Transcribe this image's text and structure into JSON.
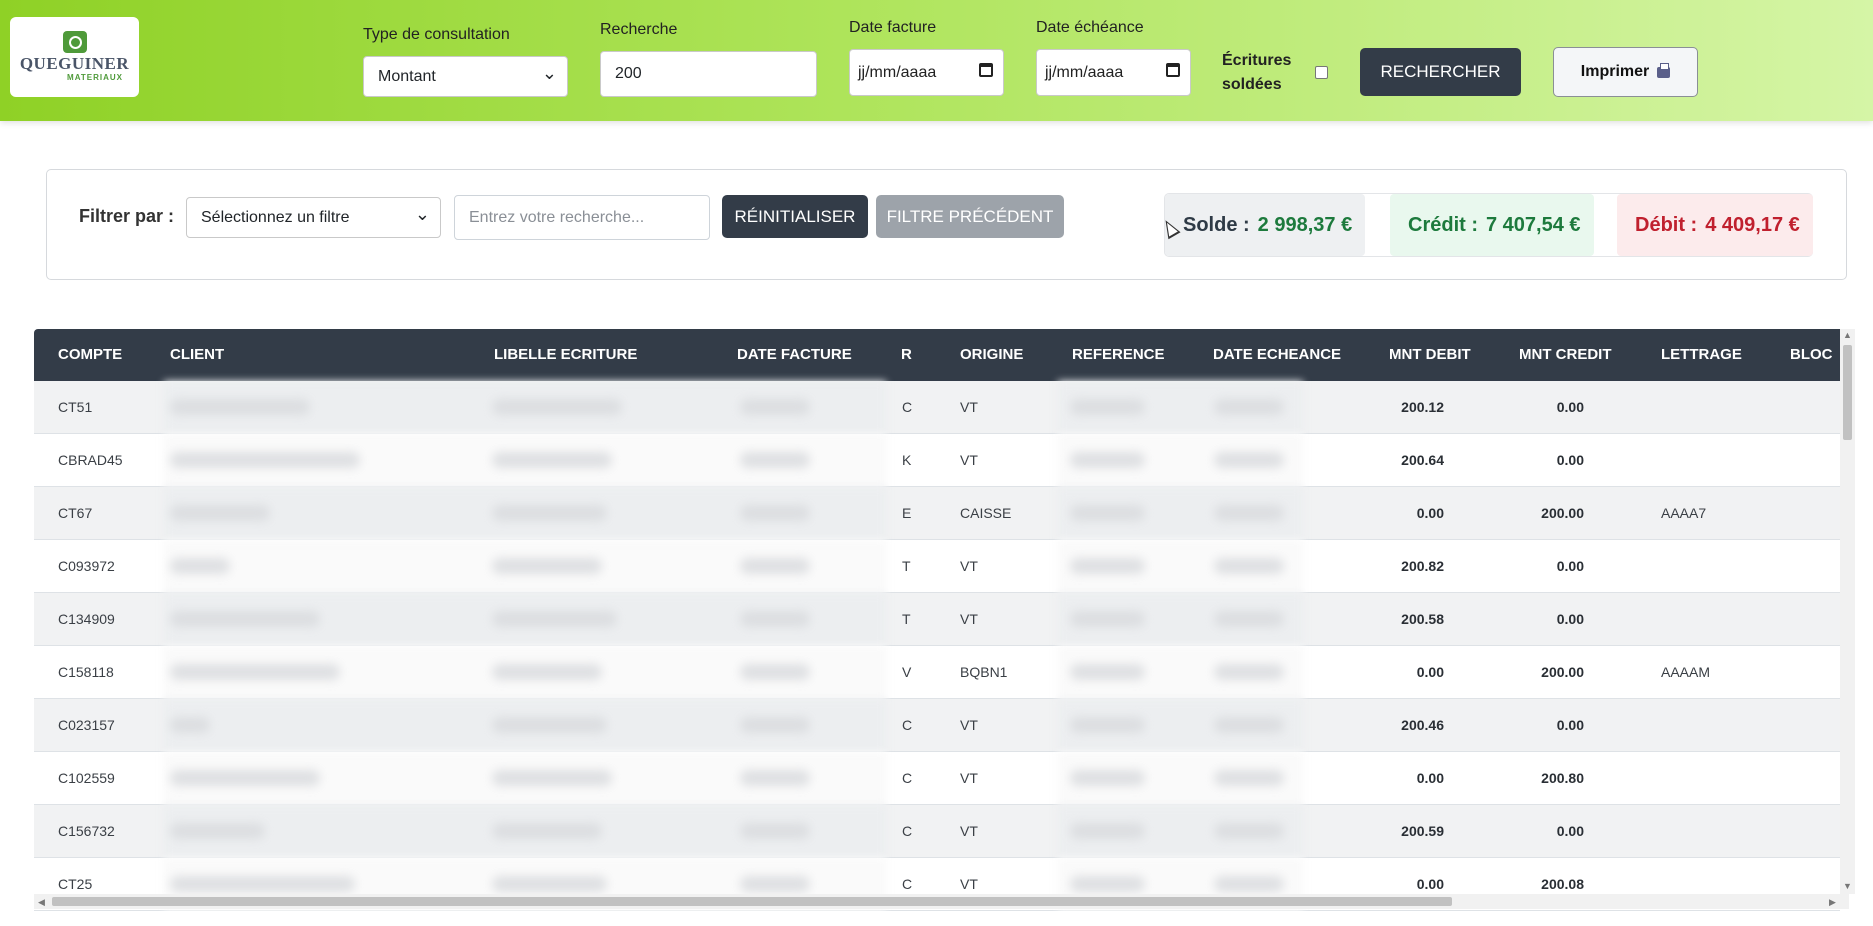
{
  "logo": {
    "title": "QUEGUINER",
    "subtitle": "MATERIAUX"
  },
  "header": {
    "type_label": "Type de consultation",
    "type_value": "Montant",
    "search_label": "Recherche",
    "search_value": "200",
    "date_facture_label": "Date facture",
    "date_facture_value": "jj/mm/aaaa",
    "date_echeance_label": "Date échéance",
    "date_echeance_value": "jj/mm/aaaa",
    "soldees_label_1": "Écritures",
    "soldees_label_2": "soldées",
    "search_button": "RECHERCHER",
    "print_button": "Imprimer"
  },
  "filter": {
    "label": "Filtrer par :",
    "select_value": "Sélectionnez un filtre",
    "input_placeholder": "Entrez votre recherche...",
    "reset_button": "RÉINITIALISER",
    "previous_button": "FILTRE PRÉCÉDENT"
  },
  "stats": {
    "solde_label": "Solde :",
    "solde_value": "2 998,37 €",
    "credit_label": "Crédit :",
    "credit_value": "7 407,54 €",
    "debit_label": "Débit :",
    "debit_value": "4 409,17 €"
  },
  "colors": {
    "header_green": "#8fd126",
    "dark": "#333c48",
    "credit_green": "#1d7a3d",
    "debit_red": "#c0202e"
  },
  "table": {
    "columns": [
      "COMPTE",
      "CLIENT",
      "LIBELLE ECRITURE",
      "DATE FACTURE",
      "R",
      "ORIGINE",
      "REFERENCE",
      "DATE ECHEANCE",
      "MNT DEBIT",
      "MNT CREDIT",
      "LETTRAGE",
      "BLOC"
    ],
    "rows": [
      {
        "compte": "CT51",
        "r": "C",
        "origine": "VT",
        "debit": "200.12",
        "credit": "0.00",
        "lettrage": ""
      },
      {
        "compte": "CBRAD45",
        "r": "K",
        "origine": "VT",
        "debit": "200.64",
        "credit": "0.00",
        "lettrage": ""
      },
      {
        "compte": "CT67",
        "r": "E",
        "origine": "CAISSE",
        "debit": "0.00",
        "credit": "200.00",
        "lettrage": "AAAA7"
      },
      {
        "compte": "C093972",
        "r": "T",
        "origine": "VT",
        "debit": "200.82",
        "credit": "0.00",
        "lettrage": ""
      },
      {
        "compte": "C134909",
        "r": "T",
        "origine": "VT",
        "debit": "200.58",
        "credit": "0.00",
        "lettrage": ""
      },
      {
        "compte": "C158118",
        "r": "V",
        "origine": "BQBN1",
        "debit": "0.00",
        "credit": "200.00",
        "lettrage": "AAAAM"
      },
      {
        "compte": "C023157",
        "r": "C",
        "origine": "VT",
        "debit": "200.46",
        "credit": "0.00",
        "lettrage": ""
      },
      {
        "compte": "C102559",
        "r": "C",
        "origine": "VT",
        "debit": "0.00",
        "credit": "200.80",
        "lettrage": ""
      },
      {
        "compte": "C156732",
        "r": "C",
        "origine": "VT",
        "debit": "200.59",
        "credit": "0.00",
        "lettrage": ""
      },
      {
        "compte": "CT25",
        "r": "C",
        "origine": "VT",
        "debit": "0.00",
        "credit": "200.08",
        "lettrage": ""
      }
    ]
  }
}
